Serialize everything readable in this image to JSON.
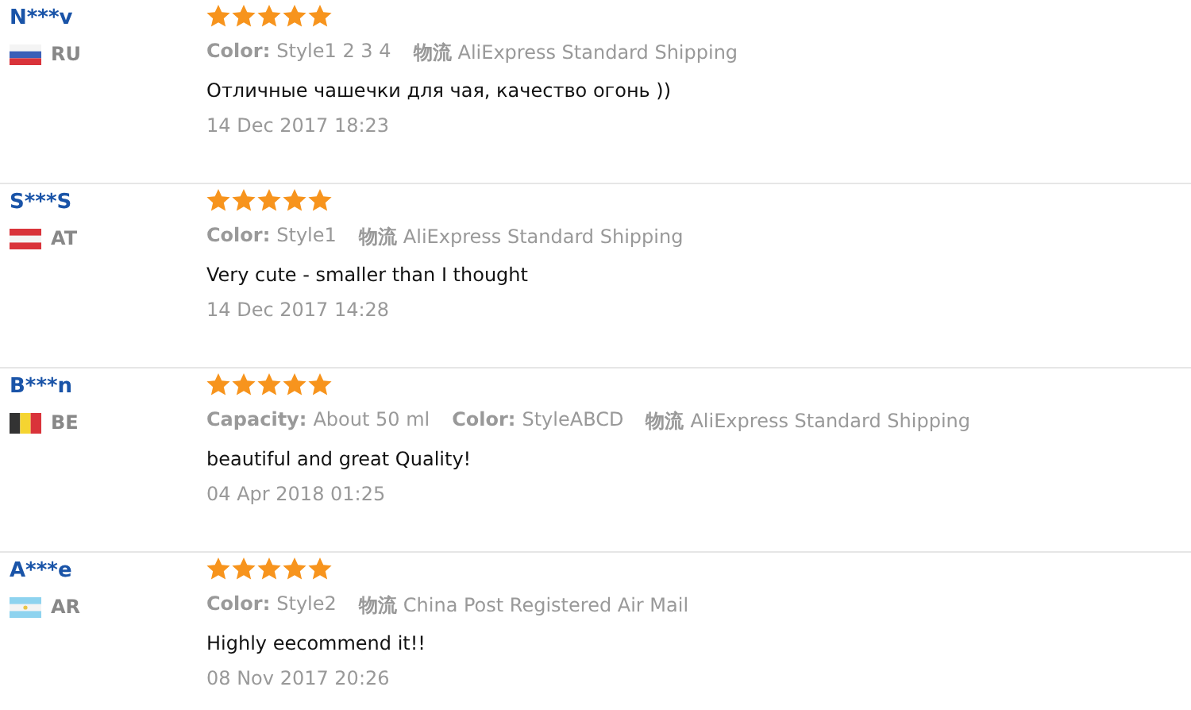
{
  "reviews": [
    {
      "user": "N***v",
      "country": "RU",
      "flag": {
        "kind": "ru"
      },
      "stars": 5,
      "attributes": [
        {
          "label": "Color:",
          "value": "Style1 2 3 4"
        },
        {
          "label": "物流",
          "value": "AliExpress Standard Shipping"
        }
      ],
      "text": "Отличные чашечки для чая, качество огонь ))",
      "date": "14 Dec 2017 18:23"
    },
    {
      "user": "S***S",
      "country": "AT",
      "flag": {
        "kind": "at"
      },
      "stars": 5,
      "attributes": [
        {
          "label": "Color:",
          "value": "Style1"
        },
        {
          "label": "物流",
          "value": "AliExpress Standard Shipping"
        }
      ],
      "text": "Very cute - smaller than I thought",
      "date": "14 Dec 2017 14:28"
    },
    {
      "user": "B***n",
      "country": "BE",
      "flag": {
        "kind": "be"
      },
      "stars": 5,
      "attributes": [
        {
          "label": "Capacity:",
          "value": "About 50 ml"
        },
        {
          "label": "Color:",
          "value": "StyleABCD"
        },
        {
          "label": "物流",
          "value": "AliExpress Standard Shipping"
        }
      ],
      "text": "beautiful and great Quality!",
      "date": "04 Apr 2018 01:25"
    },
    {
      "user": "A***e",
      "country": "AR",
      "flag": {
        "kind": "ar"
      },
      "stars": 5,
      "attributes": [
        {
          "label": "Color:",
          "value": "Style2"
        },
        {
          "label": "物流",
          "value": "China Post Registered Air Mail"
        }
      ],
      "text": "Highly eecommend it!!",
      "date": "08 Nov 2017 20:26"
    }
  ]
}
